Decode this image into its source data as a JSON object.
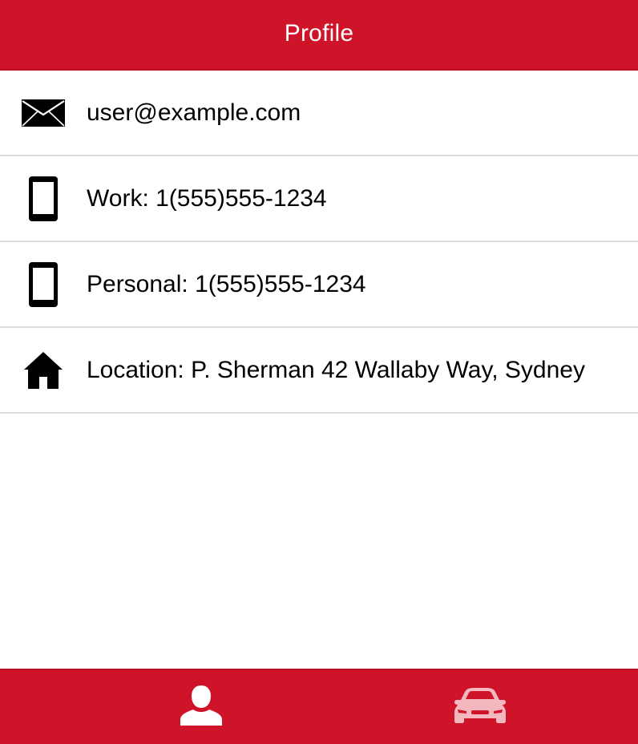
{
  "header": {
    "title": "Profile"
  },
  "profile": {
    "items": [
      {
        "icon": "envelope-icon",
        "text": "user@example.com"
      },
      {
        "icon": "mobile-phone-icon",
        "text": "Work: 1(555)555-1234"
      },
      {
        "icon": "mobile-phone-icon",
        "text": "Personal: 1(555)555-1234"
      },
      {
        "icon": "home-icon",
        "text": "Location: P. Sherman 42 Wallaby Way, Sydney"
      }
    ]
  },
  "tabbar": {
    "tabs": [
      {
        "icon": "person-icon",
        "selected": true
      },
      {
        "icon": "car-icon",
        "selected": false
      }
    ]
  },
  "colors": {
    "brand": "#cf1328",
    "divider": "#dcdcdc",
    "active_tab_icon": "#ffffff",
    "inactive_tab_icon": "#f3b8bf"
  }
}
